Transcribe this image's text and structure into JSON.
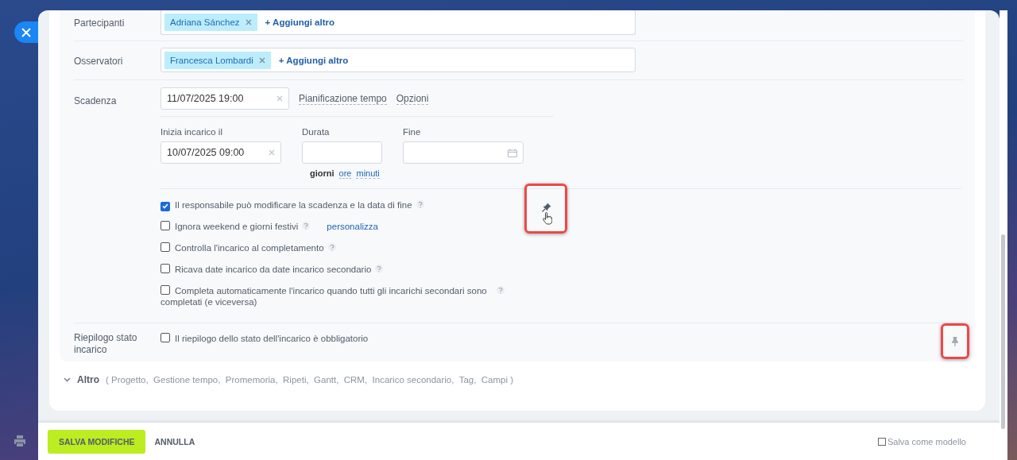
{
  "participants": {
    "label": "Partecipanti",
    "tags": [
      "Adriana Sánchez"
    ],
    "add_link": "+ Aggiungi altro"
  },
  "observers": {
    "label": "Osservatori",
    "tags": [
      "Francesca Lombardi"
    ],
    "add_link": "+ Aggiungi altro"
  },
  "deadline": {
    "label": "Scadenza",
    "value": "11/07/2025 19:00",
    "links": [
      "Pianificazione tempo",
      "Opzioni"
    ]
  },
  "schedule": {
    "fields": [
      {
        "label": "Inizia incarico il",
        "value": "10/07/2025 09:00",
        "kind": "clearable"
      },
      {
        "label": "Durata",
        "kind": "plain"
      },
      {
        "label": "Fine",
        "kind": "calendar"
      }
    ],
    "units": [
      {
        "label": "giorni",
        "selected": true
      },
      {
        "label": "ore",
        "selected": false
      },
      {
        "label": "minuti",
        "selected": false
      }
    ]
  },
  "options": [
    {
      "label": "Il responsabile può modificare la scadenza e la data di fine",
      "checked": true
    },
    {
      "label": "Ignora weekend e giorni festivi",
      "checked": false,
      "link": "personalizza"
    },
    {
      "label": "Controlla l'incarico al completamento",
      "checked": false
    },
    {
      "label": "Ricava date incarico da date incarico secondario",
      "checked": false
    },
    {
      "label": "Completa automaticamente l'incarico quando tutti gli incarichi secondari sono completati (e viceversa)",
      "checked": false
    }
  ],
  "summary": {
    "label": "Riepilogo stato incarico",
    "option": {
      "label": "Il riepilogo dello stato dell'incarico è obbligatorio",
      "checked": false
    }
  },
  "more": {
    "label": "Altro",
    "items": "( Progetto,  Gestione tempo,  Promemoria,  Ripeti,  Gantt,  CRM,  Incarico secondario,  Tag,  Campi )"
  },
  "footer": {
    "save": "SALVA MODIFICHE",
    "cancel": "ANNULLA",
    "template": {
      "label": "Salva come modello",
      "checked": false
    }
  }
}
